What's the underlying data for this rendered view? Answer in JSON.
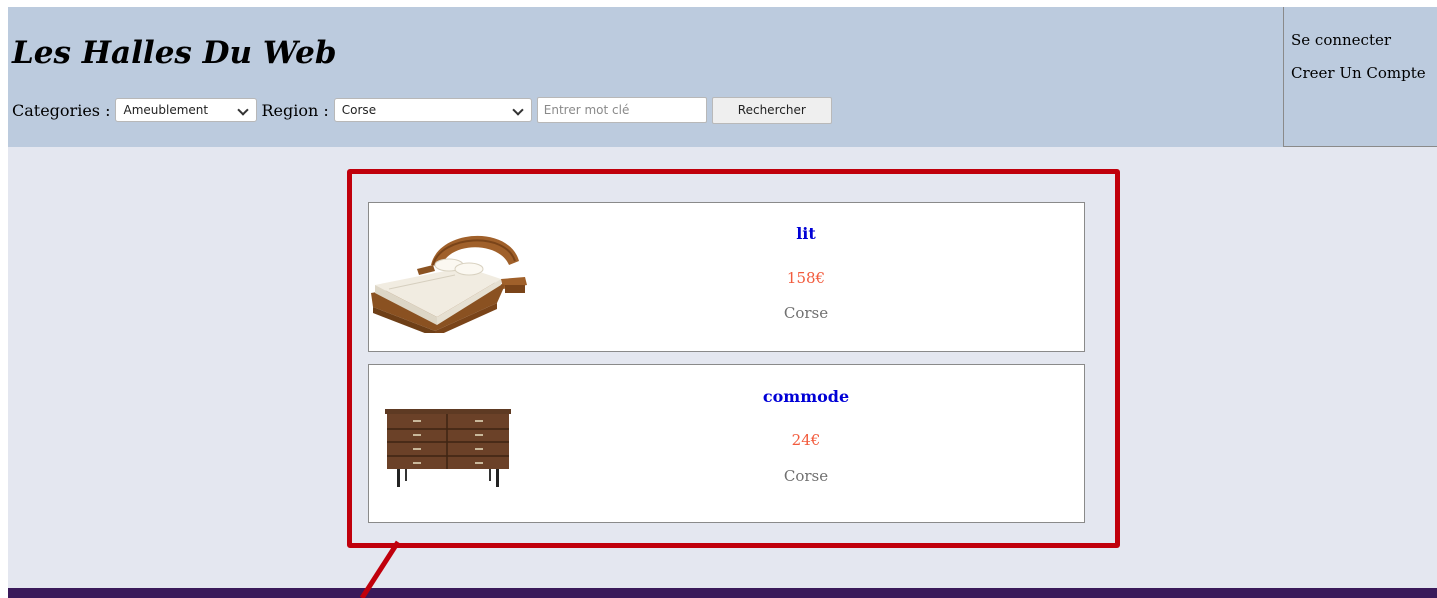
{
  "header": {
    "site_title": "Les Halles Du Web",
    "categories_label": "Categories :",
    "categories_selected": "Ameublement",
    "region_label": "Region :",
    "region_selected": "Corse",
    "search_placeholder": "Entrer mot clé",
    "search_button": "Rechercher"
  },
  "account": {
    "login": "Se connecter",
    "register": "Creer Un Compte"
  },
  "listings": [
    {
      "name": "lit",
      "price": "158€",
      "region": "Corse",
      "image_icon": "bed-image"
    },
    {
      "name": "commode",
      "price": "24€",
      "region": "Corse",
      "image_icon": "dresser-image"
    }
  ],
  "colors": {
    "header_bg": "#bccbde",
    "page_bg": "#e4e7f0",
    "highlight_border": "#c0000c",
    "item_name": "#0000d6",
    "item_price": "#f25b3d",
    "item_region": "#707070",
    "footer": "#3a1a5a"
  }
}
